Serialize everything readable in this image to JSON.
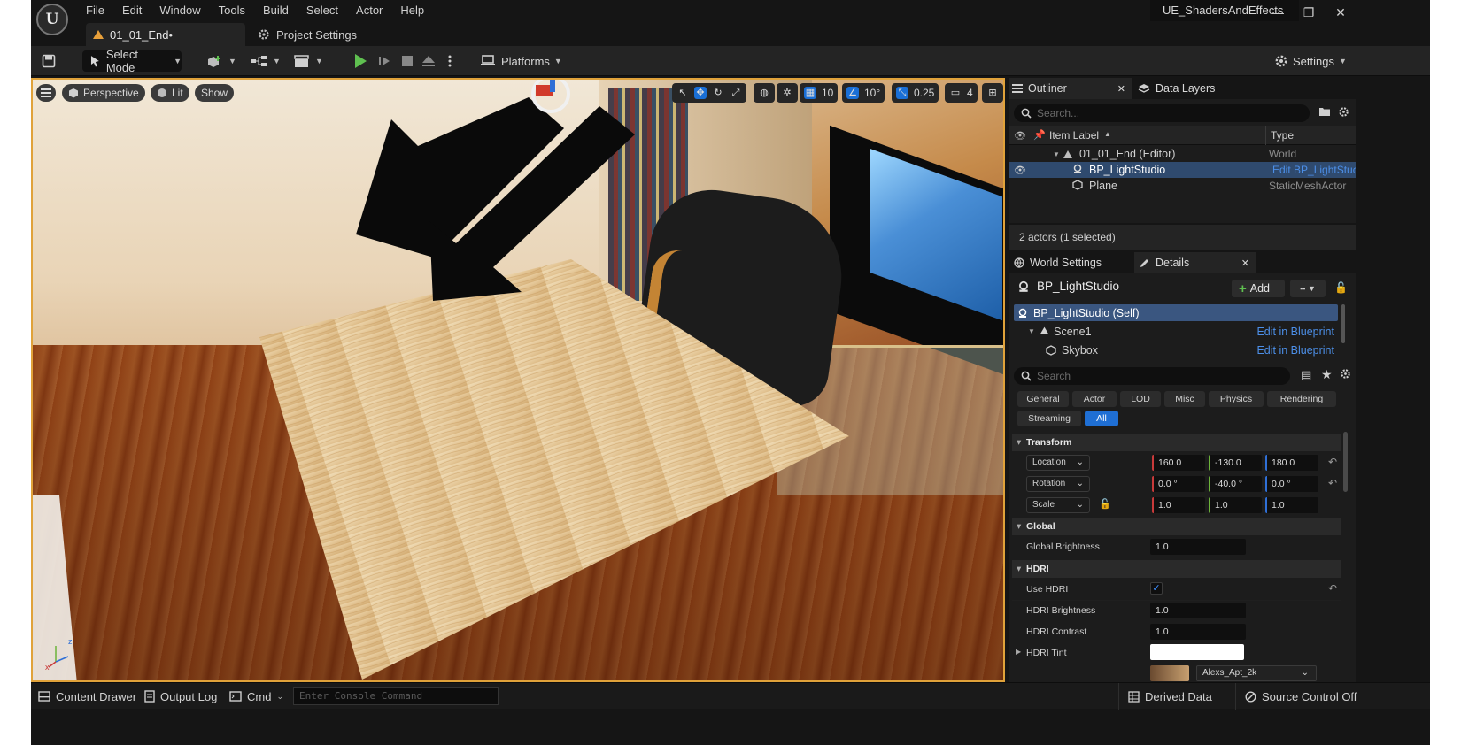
{
  "window": {
    "project_name": "UE_ShadersAndEffects",
    "logo_letter": "U",
    "minimize_glyph": "—",
    "restore_glyph": "❐",
    "close_glyph": "✕"
  },
  "menu": [
    "File",
    "Edit",
    "Window",
    "Tools",
    "Build",
    "Select",
    "Actor",
    "Help"
  ],
  "tabs": {
    "level": "01_01_End•",
    "project_settings": "Project Settings"
  },
  "toolbar": {
    "select_mode": "Select Mode",
    "platforms": "Platforms",
    "settings": "Settings"
  },
  "viewport": {
    "perspective": "Perspective",
    "lit": "Lit",
    "show": "Show",
    "grid_snap": "10",
    "rotation_snap": "10°",
    "scale_snap": "0.25",
    "camera_speed": "4"
  },
  "outliner": {
    "tab_label": "Outliner",
    "data_layers_tab": "Data Layers",
    "search_placeholder": "Search...",
    "col_item_label": "Item Label",
    "col_type": "Type",
    "rows": [
      {
        "label": "01_01_End (Editor)",
        "type": "World"
      },
      {
        "label": "BP_LightStudio",
        "type": "Edit BP_LightStuc"
      },
      {
        "label": "Plane",
        "type": "StaticMeshActor"
      }
    ],
    "status": "2 actors (1 selected)"
  },
  "details": {
    "world_settings_tab": "World Settings",
    "details_tab": "Details",
    "actor_name": "BP_LightStudio",
    "add_label": "Add",
    "components": [
      {
        "label": "BP_LightStudio (Self)",
        "link": ""
      },
      {
        "label": "Scene1",
        "link": "Edit in Blueprint"
      },
      {
        "label": "Skybox",
        "link": "Edit in Blueprint"
      }
    ],
    "search_placeholder": "Search",
    "filters": [
      "General",
      "Actor",
      "LOD",
      "Misc",
      "Physics",
      "Rendering",
      "Streaming",
      "All"
    ],
    "active_filter": "All",
    "transform": {
      "section": "Transform",
      "location_label": "Location",
      "location": [
        "160.0",
        "-130.0",
        "180.0"
      ],
      "rotation_label": "Rotation",
      "rotation": [
        "0.0 °",
        "-40.0 °",
        "0.0 °"
      ],
      "scale_label": "Scale",
      "scale": [
        "1.0",
        "1.0",
        "1.0"
      ]
    },
    "global": {
      "section": "Global",
      "brightness_label": "Global Brightness",
      "brightness": "1.0"
    },
    "hdri": {
      "section": "HDRI",
      "use_hdri_label": "Use HDRI",
      "use_hdri": true,
      "brightness_label": "HDRI Brightness",
      "brightness": "1.0",
      "contrast_label": "HDRI Contrast",
      "contrast": "1.0",
      "tint_label": "HDRI Tint",
      "tint_color": "#ffffff",
      "texture": "Alexs_Apt_2k"
    }
  },
  "statusbar": {
    "content_drawer": "Content Drawer",
    "output_log": "Output Log",
    "cmd": "Cmd",
    "console_placeholder": "Enter Console Command",
    "derived_data": "Derived Data",
    "source_control": "Source Control Off"
  },
  "colors": {
    "accent": "#1f6fd4",
    "viewport_border": "#e0a23a",
    "link": "#4c8fe8",
    "play": "#5fc050"
  }
}
